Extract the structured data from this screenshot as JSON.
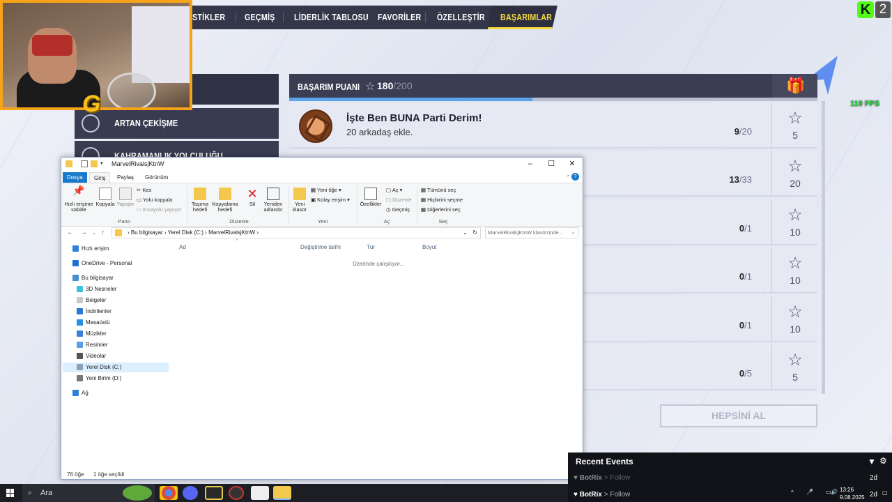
{
  "game": {
    "nav": {
      "items": [
        "İSTATİSTİKLER",
        "GEÇMİŞ",
        "LİDERLİK TABLOSU",
        "FAVORİLER",
        "ÖZELLEŞTİR"
      ],
      "items_visible": [
        "STİKLER",
        "GEÇMİŞ",
        "LİDERLİK TABLOSU",
        "FAVORİLER",
        "ÖZELLEŞTİR"
      ],
      "active": "BAŞARIMLAR"
    },
    "left_list": [
      {
        "label": "ARTAN ÇEKİŞME",
        "icon": "target-icon"
      },
      {
        "label": "KAHRAMANLIK YOLCULUĞU",
        "icon": "compass-icon"
      }
    ],
    "header": {
      "title": "BAŞARIM PUANI",
      "points": "180",
      "max": "/200",
      "progress": 0.46
    },
    "achievements": [
      {
        "title": "İşte Ben BUNA Parti Derim!",
        "desc": "20 arkadaş ekle.",
        "done": "9",
        "total": "/20",
        "reward": "5"
      },
      {
        "title": "",
        "desc": "",
        "done": "13",
        "total": "/33",
        "reward": "20"
      },
      {
        "title": "",
        "desc": "",
        "done": "0",
        "total": "/1",
        "reward": "10"
      },
      {
        "title": "",
        "desc": "",
        "done": "0",
        "total": "/1",
        "reward": "10"
      },
      {
        "title": "",
        "desc": "",
        "done": "0",
        "total": "/1",
        "reward": "10"
      },
      {
        "title": "",
        "desc": "",
        "done": "0",
        "total": "/5",
        "reward": "5"
      }
    ],
    "claim_all": "HEPSİNİ AL",
    "fps": "119 FPS"
  },
  "stream": {
    "kick_badge": "K",
    "viewer_count": "2"
  },
  "explorer": {
    "title": "MarvelRivalsjKtnW",
    "tabs": [
      "Dosya",
      "Giriş",
      "Paylaş",
      "Görünüm"
    ],
    "ribbon": {
      "pin": "Hızlı erişime sabitle",
      "copy": "Kopyala",
      "paste": "Yapıştır",
      "cut": "Kes",
      "copy_path": "Yolu kopyala",
      "paste_shortcut": "Kısayolu yapıştır",
      "move_to": "Taşıma hedefi",
      "copy_to": "Kopyalama hedefi",
      "delete": "Sil",
      "rename": "Yeniden adlandır",
      "new_folder": "Yeni klasör",
      "new_item": "Yeni öğe",
      "easy_access": "Kolay erişim",
      "properties": "Özellikler",
      "open": "Aç",
      "edit": "Düzenle",
      "history": "Geçmiş",
      "select_all": "Tümünü seç",
      "select_none": "Hiçbirini seçme",
      "invert": "Diğerlerini seç",
      "groups": [
        "Pano",
        "Düzenle",
        "Yeni",
        "Aç",
        "Seç"
      ]
    },
    "breadcrumb": [
      "Bu bilgisayar",
      "Yerel Disk (C:)",
      "MarvelRivalsjKtnW"
    ],
    "search_placeholder": "MarvelRivalsjKtnW klasöründe...",
    "tree": [
      {
        "label": "Hızlı erişim",
        "level": 0,
        "color": "#2f7fd6"
      },
      {
        "label": "OneDrive - Personal",
        "level": 0,
        "color": "#1f6fd1"
      },
      {
        "label": "Bu bilgisayar",
        "level": 0,
        "color": "#4a90d0"
      },
      {
        "label": "3D Nesneler",
        "level": 1,
        "color": "#3ec1e0"
      },
      {
        "label": "Belgeler",
        "level": 1,
        "color": "#c8c8c8"
      },
      {
        "label": "İndirilenler",
        "level": 1,
        "color": "#2b78d3"
      },
      {
        "label": "Masaüstü",
        "level": 1,
        "color": "#2b8ee6"
      },
      {
        "label": "Müzikler",
        "level": 1,
        "color": "#3a7fd8"
      },
      {
        "label": "Resimler",
        "level": 1,
        "color": "#5c9fe0"
      },
      {
        "label": "Videolar",
        "level": 1,
        "color": "#555"
      },
      {
        "label": "Yerel Disk (C:)",
        "level": 1,
        "color": "#8aa0b8"
      },
      {
        "label": "Yeni Birim (D:)",
        "level": 1,
        "color": "#777"
      },
      {
        "label": "Ağ",
        "level": 0,
        "color": "#2f7fd6"
      }
    ],
    "columns": [
      "Ad",
      "Değiştirme tarihi",
      "Tür",
      "Boyut"
    ],
    "working_text": "Üzerinde çalışılıyor...",
    "status_count": "76 öğe",
    "status_selected": "1 öğe seçildi"
  },
  "events": {
    "title": "Recent Events",
    "items": [
      {
        "user": "BotRix",
        "action": "> Follow",
        "age": "2d"
      },
      {
        "user": "BotRix",
        "action": "> Follow",
        "age": "2d"
      }
    ]
  },
  "taskbar": {
    "search": "Ara",
    "time": "13:26",
    "date": "9.08.2025"
  }
}
